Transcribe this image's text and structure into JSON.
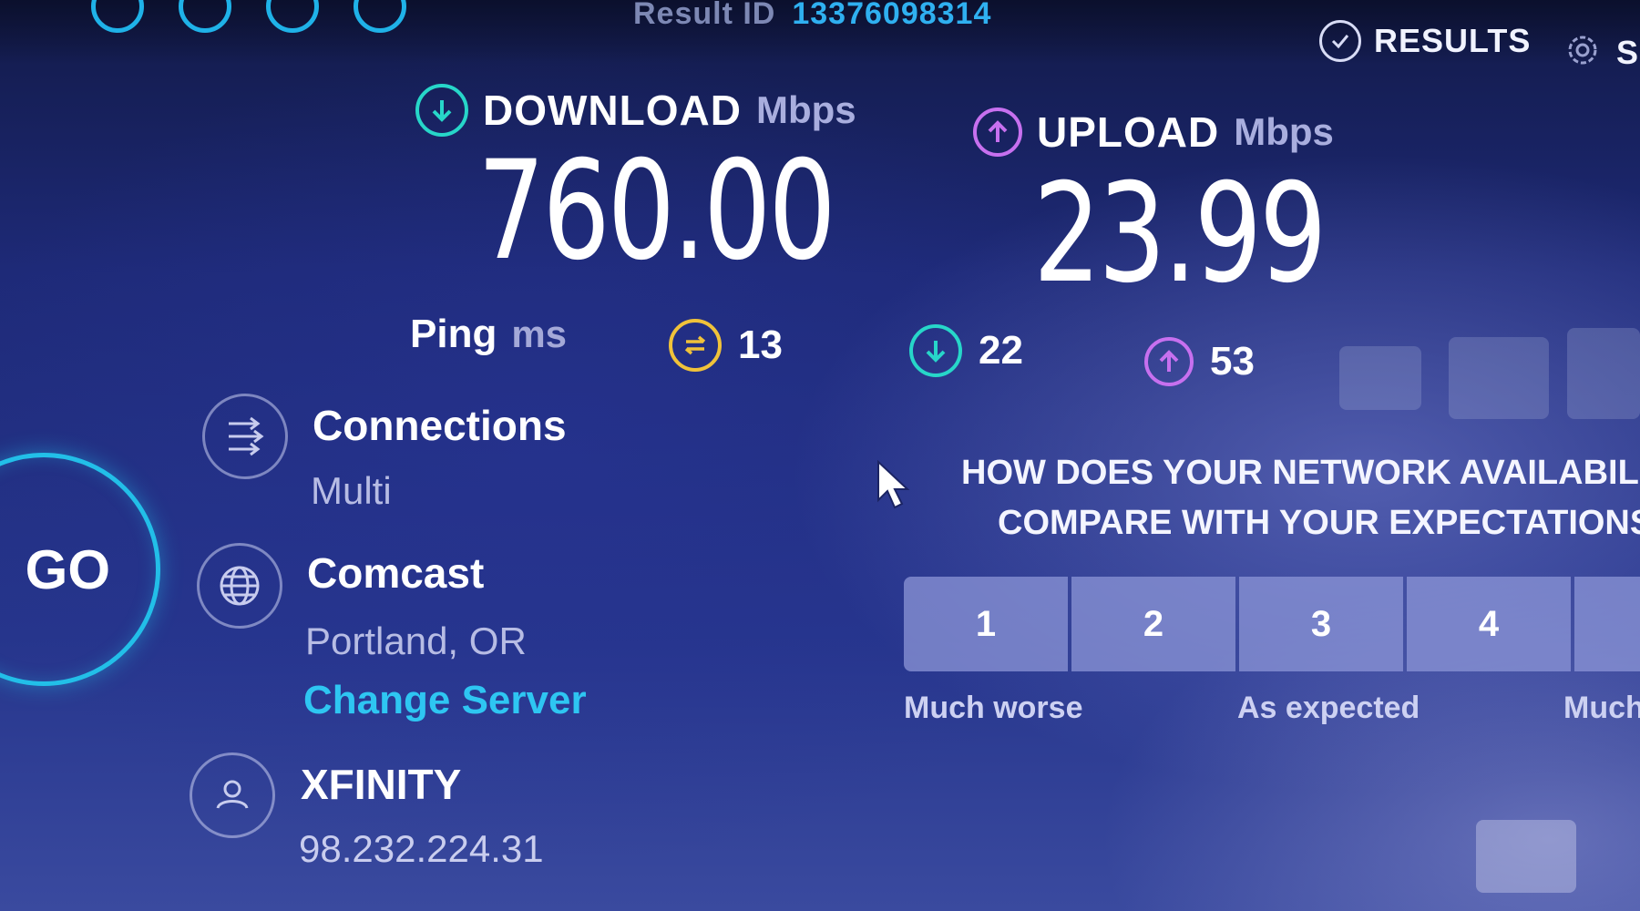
{
  "header": {
    "result_id_label": "Result ID",
    "result_id": "13376098314",
    "nav": [
      {
        "label": "RESULTS",
        "icon": "checkmark-circle-icon"
      },
      {
        "label": "S",
        "icon": "gear-icon"
      }
    ]
  },
  "download": {
    "label": "DOWNLOAD",
    "unit": "Mbps",
    "value": "760.00",
    "icon": "download-arrow-icon",
    "color": "#27d6c9"
  },
  "upload": {
    "label": "UPLOAD",
    "unit": "Mbps",
    "value": "23.99",
    "icon": "upload-arrow-icon",
    "color": "#c770ef"
  },
  "ping": {
    "label": "Ping",
    "unit": "ms",
    "idle": {
      "value": "13",
      "icon": "idle-latency-icon",
      "color": "#f0c23a"
    },
    "download": {
      "value": "22",
      "icon": "download-latency-icon",
      "color": "#27d6c9"
    },
    "upload": {
      "value": "53",
      "icon": "upload-latency-icon",
      "color": "#c770ef"
    }
  },
  "go_button": {
    "label": "GO"
  },
  "connections": {
    "title": "Connections",
    "value": "Multi",
    "icon": "connections-icon"
  },
  "server": {
    "title": "Comcast",
    "location": "Portland, OR",
    "change_label": "Change Server",
    "icon": "globe-icon"
  },
  "provider": {
    "title": "XFINITY",
    "ip": "98.232.224.31",
    "icon": "user-icon"
  },
  "survey": {
    "question_line1": "HOW DOES YOUR NETWORK AVAILABILI",
    "question_line2": "COMPARE WITH YOUR EXPECTATIONS",
    "options": [
      "1",
      "2",
      "3",
      "4"
    ],
    "labels": [
      "Much worse",
      "As expected",
      "Much"
    ]
  }
}
